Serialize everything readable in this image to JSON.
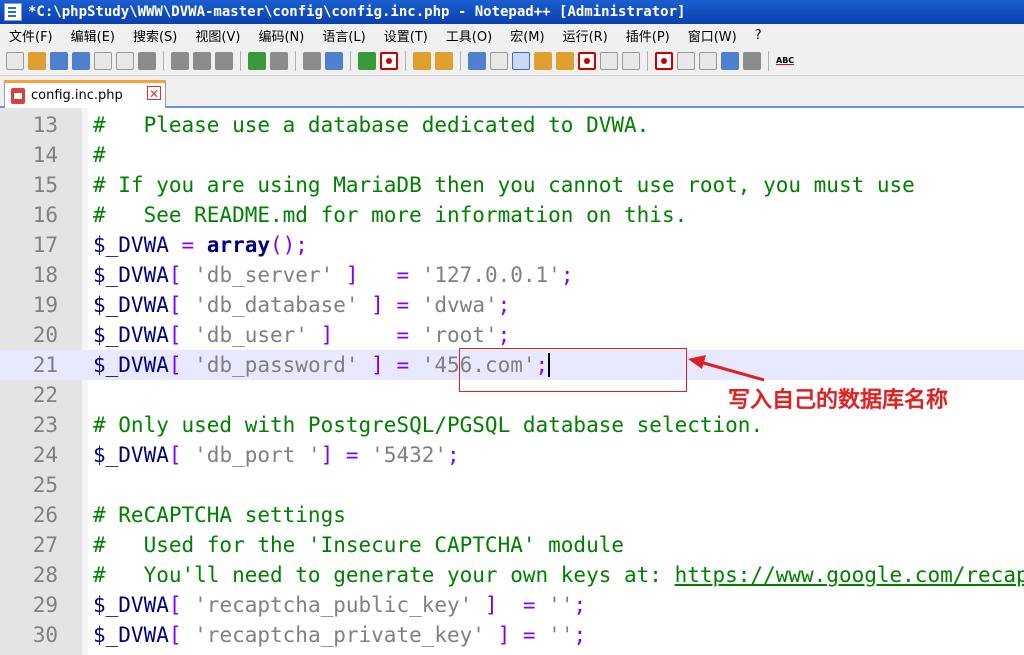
{
  "window": {
    "title": "*C:\\phpStudy\\WWW\\DVWA-master\\config\\config.inc.php - Notepad++ [Administrator]"
  },
  "menu": [
    "文件(F)",
    "编辑(E)",
    "搜索(S)",
    "视图(V)",
    "编码(N)",
    "语言(L)",
    "设置(T)",
    "工具(O)",
    "宏(M)",
    "运行(R)",
    "插件(P)",
    "窗口(W)",
    "?"
  ],
  "toolbar": {
    "spellcheck_label": "ABC"
  },
  "tab": {
    "filename": "config.inc.php",
    "close_glyph": "✕"
  },
  "editor": {
    "lines": [
      {
        "n": 13,
        "parts": [
          [
            "c",
            "#   Please use a database dedicated to DVWA."
          ]
        ]
      },
      {
        "n": 14,
        "parts": [
          [
            "c",
            "#"
          ]
        ]
      },
      {
        "n": 15,
        "parts": [
          [
            "c",
            "# If you are using MariaDB then you cannot use root, you must use"
          ]
        ]
      },
      {
        "n": 16,
        "parts": [
          [
            "c",
            "#   See README.md for more information on this."
          ]
        ]
      },
      {
        "n": 17,
        "parts": [
          [
            "v",
            "$_DVWA"
          ],
          [
            "o",
            " = "
          ],
          [
            "k",
            "array"
          ],
          [
            "o",
            "();"
          ]
        ]
      },
      {
        "n": 18,
        "parts": [
          [
            "v",
            "$_DVWA"
          ],
          [
            "o",
            "[ "
          ],
          [
            "s",
            "'db_server'"
          ],
          [
            "o",
            " ]   = "
          ],
          [
            "s",
            "'127.0.0.1'"
          ],
          [
            "o",
            ";"
          ]
        ]
      },
      {
        "n": 19,
        "parts": [
          [
            "v",
            "$_DVWA"
          ],
          [
            "o",
            "[ "
          ],
          [
            "s",
            "'db_database'"
          ],
          [
            "o",
            " ] = "
          ],
          [
            "s",
            "'dvwa'"
          ],
          [
            "o",
            ";"
          ]
        ]
      },
      {
        "n": 20,
        "parts": [
          [
            "v",
            "$_DVWA"
          ],
          [
            "o",
            "[ "
          ],
          [
            "s",
            "'db_user'"
          ],
          [
            "o",
            " ]     = "
          ],
          [
            "s",
            "'root'"
          ],
          [
            "o",
            ";"
          ]
        ]
      },
      {
        "n": 21,
        "parts": [
          [
            "v",
            "$_DVWA"
          ],
          [
            "o",
            "[ "
          ],
          [
            "s",
            "'db_password'"
          ],
          [
            "o",
            " ] = "
          ],
          [
            "s",
            "'456.com'"
          ],
          [
            "o",
            ";"
          ]
        ],
        "current": true
      },
      {
        "n": 22,
        "parts": []
      },
      {
        "n": 23,
        "parts": [
          [
            "c",
            "# Only used with PostgreSQL/PGSQL database selection."
          ]
        ]
      },
      {
        "n": 24,
        "parts": [
          [
            "v",
            "$_DVWA"
          ],
          [
            "o",
            "[ "
          ],
          [
            "s",
            "'db_port '"
          ],
          [
            "o",
            "] = "
          ],
          [
            "s",
            "'5432'"
          ],
          [
            "o",
            ";"
          ]
        ]
      },
      {
        "n": 25,
        "parts": []
      },
      {
        "n": 26,
        "parts": [
          [
            "c",
            "# ReCAPTCHA settings"
          ]
        ]
      },
      {
        "n": 27,
        "parts": [
          [
            "c",
            "#   Used for the 'Insecure CAPTCHA' module"
          ]
        ]
      },
      {
        "n": 28,
        "parts": [
          [
            "c",
            "#   You'll need to generate your own keys at: "
          ],
          [
            "cu",
            "https://www.google.com/recaptcha/admin"
          ]
        ]
      },
      {
        "n": 29,
        "parts": [
          [
            "v",
            "$_DVWA"
          ],
          [
            "o",
            "[ "
          ],
          [
            "s",
            "'recaptcha_public_key'"
          ],
          [
            "o",
            " ]  = "
          ],
          [
            "s",
            "''"
          ],
          [
            "o",
            ";"
          ]
        ]
      },
      {
        "n": 30,
        "parts": [
          [
            "v",
            "$_DVWA"
          ],
          [
            "o",
            "[ "
          ],
          [
            "s",
            "'recaptcha_private_key'"
          ],
          [
            "o",
            " ] = "
          ],
          [
            "s",
            "''"
          ],
          [
            "o",
            ";"
          ]
        ]
      }
    ]
  },
  "annotation": {
    "text": "写入自己的数据库名称",
    "color": "#e02020"
  }
}
